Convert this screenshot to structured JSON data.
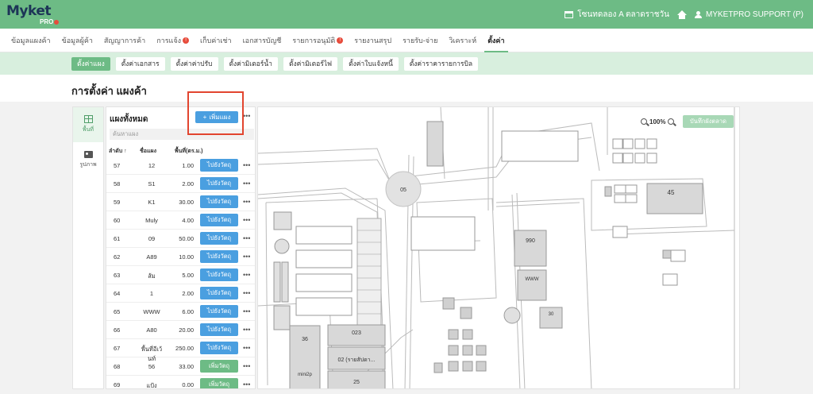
{
  "brand": {
    "name": "Myket",
    "suffix": "PRO"
  },
  "topbar": {
    "market": "โซนทดลอง A ตลาดราชวัน",
    "user": "MYKETPRO SUPPORT (P)"
  },
  "nav": [
    {
      "label": "ข้อมูลแผงค้า"
    },
    {
      "label": "ข้อมูลผู้ค้า"
    },
    {
      "label": "สัญญาการค้า"
    },
    {
      "label": "การแจ้ง",
      "badge": "!"
    },
    {
      "label": "เก็บค่าเช่า"
    },
    {
      "label": "เอกสารบัญชี"
    },
    {
      "label": "รายการอนุมัติ",
      "badge": "!"
    },
    {
      "label": "รายงานสรุป"
    },
    {
      "label": "รายรับ-จ่าย"
    },
    {
      "label": "วิเคราะห์"
    },
    {
      "label": "ตั้งค่า",
      "active": true
    }
  ],
  "subnav": [
    {
      "label": "ตั้งค่าแผง",
      "active": true
    },
    {
      "label": "ตั้งค่าเอกสาร"
    },
    {
      "label": "ตั้งค่าค่าปรับ"
    },
    {
      "label": "ตั้งค่ามิเตอร์น้ำ"
    },
    {
      "label": "ตั้งค่ามิเตอร์ไฟ"
    },
    {
      "label": "ตั้งค่าใบแจ้งหนี้"
    },
    {
      "label": "ตั้งค่าราคารายการบิล"
    }
  ],
  "page": {
    "title": "การตั้งค่า แผงค้า"
  },
  "side_tabs": [
    {
      "label": "พื้นที่",
      "icon": "grid-icon",
      "active": true
    },
    {
      "label": "รูปภาพ",
      "icon": "image-icon"
    }
  ],
  "panel": {
    "title": "แผงทั้งหมด",
    "add_label": "เพิ่มแผง",
    "search_placeholder": "ค้นหาแผง",
    "columns": {
      "no": "ลำดับ ↑",
      "name": "ชื่อแผง",
      "area": "พื้นที่(ตร.ม.)"
    },
    "rows": [
      {
        "no": "57",
        "name": "12",
        "area": "1.00",
        "action": "ไปยังวัตถุ",
        "kind": "blue"
      },
      {
        "no": "58",
        "name": "S1",
        "area": "2.00",
        "action": "ไปยังวัตถุ",
        "kind": "blue"
      },
      {
        "no": "59",
        "name": "K1",
        "area": "30.00",
        "action": "ไปยังวัตถุ",
        "kind": "blue"
      },
      {
        "no": "60",
        "name": "Muly",
        "area": "4.00",
        "action": "ไปยังวัตถุ",
        "kind": "blue"
      },
      {
        "no": "61",
        "name": "09",
        "area": "50.00",
        "action": "ไปยังวัตถุ",
        "kind": "blue"
      },
      {
        "no": "62",
        "name": "A89",
        "area": "10.00",
        "action": "ไปยังวัตถุ",
        "kind": "blue"
      },
      {
        "no": "63",
        "name": "ส้ม",
        "area": "5.00",
        "action": "ไปยังวัตถุ",
        "kind": "blue"
      },
      {
        "no": "64",
        "name": "1",
        "area": "2.00",
        "action": "ไปยังวัตถุ",
        "kind": "blue"
      },
      {
        "no": "65",
        "name": "WWW",
        "area": "6.00",
        "action": "ไปยังวัตถุ",
        "kind": "blue"
      },
      {
        "no": "66",
        "name": "A80",
        "area": "20.00",
        "action": "ไปยังวัตถุ",
        "kind": "blue"
      },
      {
        "no": "67",
        "name": "พื้นที่อีเว้นท์",
        "area": "250.00",
        "action": "ไปยังวัตถุ",
        "kind": "blue"
      },
      {
        "no": "68",
        "name": "56",
        "area": "33.00",
        "action": "เพิ่มวัตถุ",
        "kind": "green"
      },
      {
        "no": "69",
        "name": "แป้ง",
        "area": "0.00",
        "action": "เพิ่มวัตถุ",
        "kind": "green"
      }
    ]
  },
  "map": {
    "zoom": "100%",
    "save_label": "บันทึกผังตลาด",
    "labels": {
      "roundabout": "05",
      "big_stall": "990",
      "www": "WWW",
      "thirty": "30",
      "fortyfive": "45",
      "stall_023": "023",
      "stall_36": "36",
      "stall_02": "02 (รายสัปดา...",
      "mini": "mini2p",
      "stall_25": "25"
    }
  }
}
